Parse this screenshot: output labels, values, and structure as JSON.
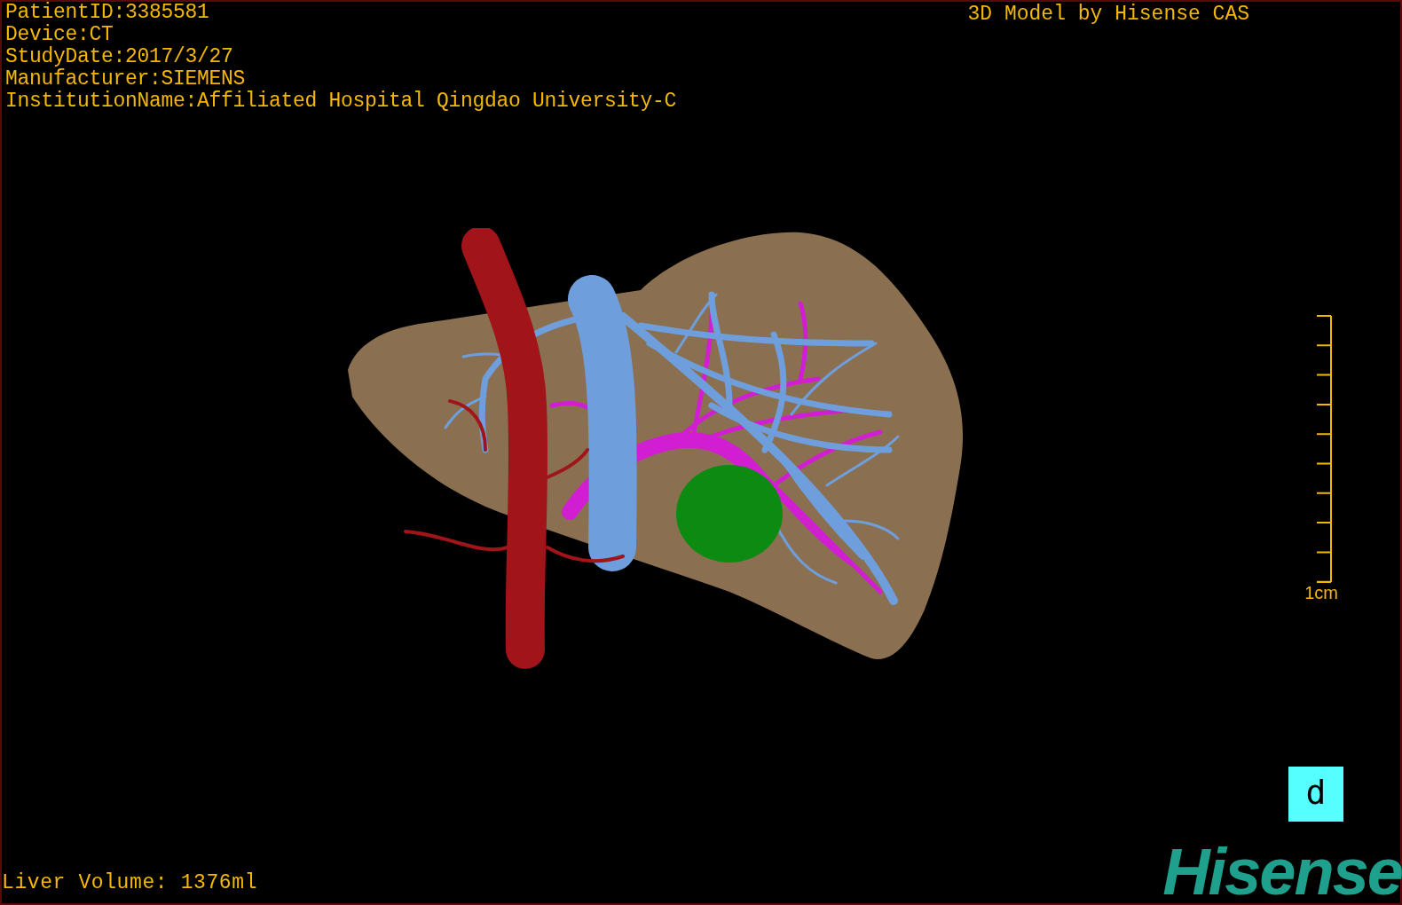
{
  "patient_info": [
    "PatientID:3385581",
    "Device:CT",
    "StudyDate:2017/3/27",
    "Manufacturer:SIEMENS",
    "InstitutionName:Affiliated Hospital Qingdao University-C"
  ],
  "title": "3D Model by Hisense CAS",
  "scale_bar": {
    "label": "1cm"
  },
  "panel_label": "d",
  "liver_volume": "Liver Volume: 1376ml",
  "logo": "Hisense"
}
